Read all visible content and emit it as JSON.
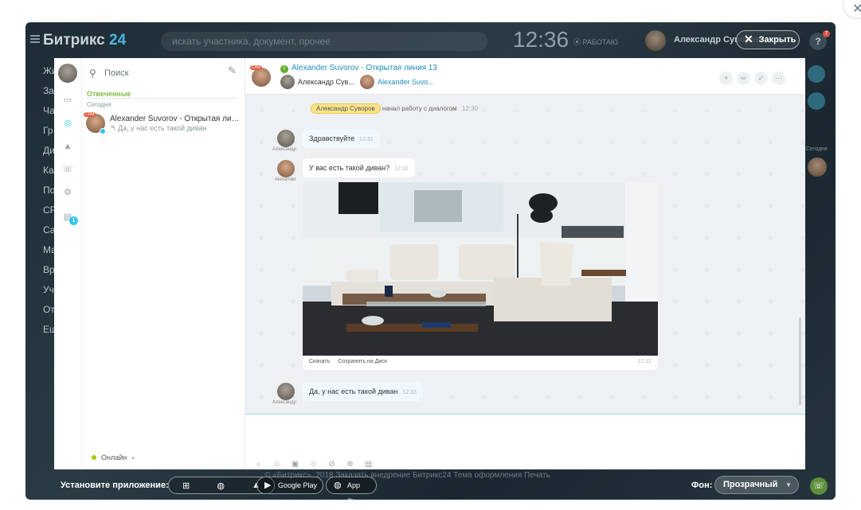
{
  "background_app": {
    "logo_text": "Битрикс",
    "logo_num": "24",
    "search_placeholder": "искать участника, документ, прочее",
    "clock": "12:36",
    "work_status": "РАБОТАЮ",
    "user_name": "Александр Суворов",
    "help_label": "?",
    "help_badge": "7",
    "menu_items": [
      "Жи",
      "За",
      "Ча",
      "Гр",
      "Ди",
      "Ка",
      "По",
      "CR",
      "Са",
      "Ма",
      "Вр",
      "Уч",
      "От",
      "Ещ"
    ],
    "right_today": "Сегодня"
  },
  "close_button": {
    "label": "Закрыть"
  },
  "messenger": {
    "search_placeholder": "Поиск",
    "section_label": "Отвеченные",
    "day_label": "Сегодня",
    "recent_chat": {
      "title": "Alexander Suvorov - Открытая линия 13",
      "last_message": "Да, у нас есть такой диван",
      "badge": "CRM"
    },
    "status": "Онлайн",
    "notifications_badge": "1"
  },
  "dialog": {
    "title": "Alexander Suvorov - Открытая линия 13",
    "member1": "Александр Сув...",
    "member2": "Alexander Suvo...",
    "header_badge": "CRM",
    "system_message": {
      "who": "Александр Суворов",
      "text": "начал работу с диалогом",
      "time": "12:30"
    },
    "messages": [
      {
        "author": "Александр",
        "text": "Здравствуйте",
        "time": "12:31"
      },
      {
        "author": "Alexander",
        "text": "У вас есть такой диван?",
        "time": "12:32"
      },
      {
        "author": "Alexander",
        "image": true,
        "download": "Скачать",
        "save": "Сохранить на Диск",
        "time": "12:32"
      },
      {
        "author": "Александр",
        "text": "Да, у нас есть такой диван",
        "time": "12:33"
      }
    ]
  },
  "bottom_bar": {
    "install_label": "Установите приложение:",
    "google_play": "Google Play",
    "app_store": "App Store",
    "copyright": "© «Битрикс», 2018   Заказать внедрение Битрикс24   Тема оформления   Печать",
    "background_label": "Фон:",
    "background_value": "Прозрачный"
  }
}
